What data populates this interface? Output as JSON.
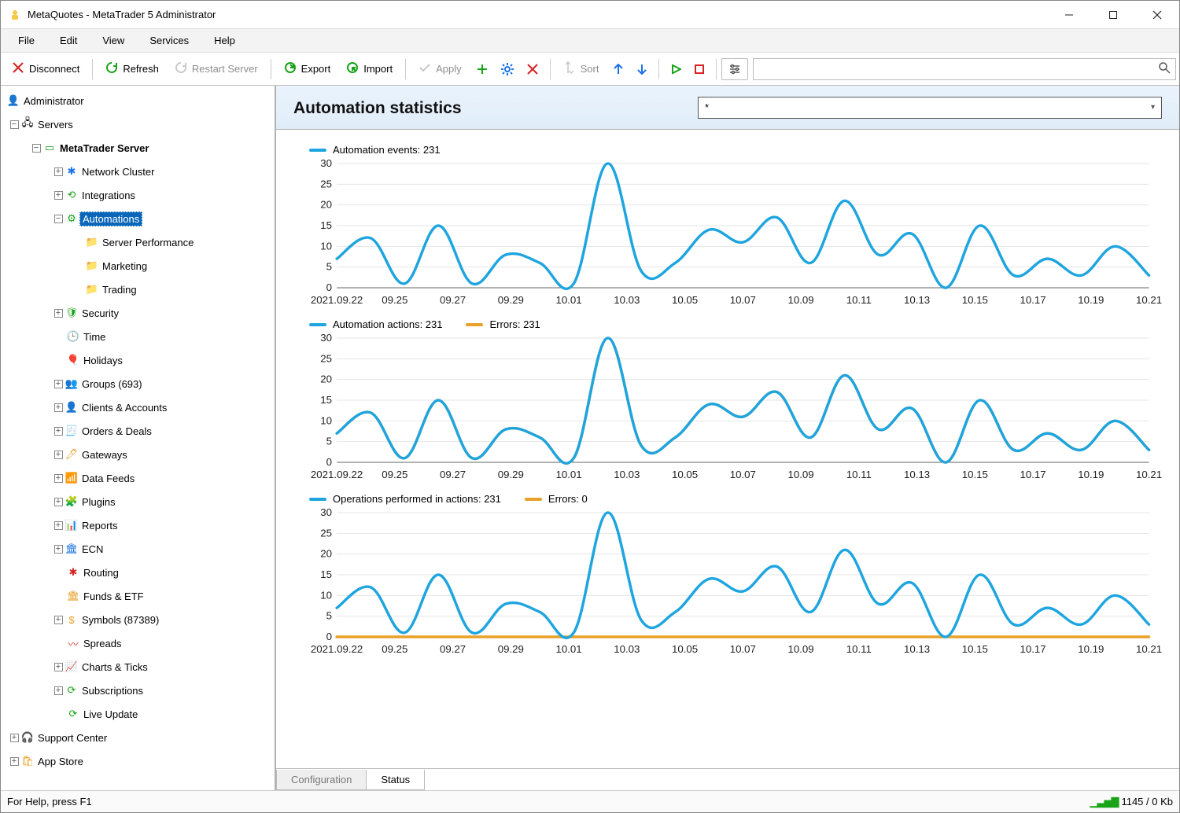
{
  "window": {
    "title": "MetaQuotes - MetaTrader 5 Administrator"
  },
  "menu": {
    "file": "File",
    "edit": "Edit",
    "view": "View",
    "services": "Services",
    "help": "Help"
  },
  "toolbar": {
    "disconnect": "Disconnect",
    "refresh": "Refresh",
    "restart": "Restart Server",
    "export": "Export",
    "import": "Import",
    "apply": "Apply",
    "sort": "Sort"
  },
  "tree": {
    "root": "Administrator",
    "servers": "Servers",
    "mtserver": "MetaTrader Server",
    "network_cluster": "Network Cluster",
    "integrations": "Integrations",
    "automations": "Automations",
    "server_performance": "Server Performance",
    "marketing": "Marketing",
    "trading": "Trading",
    "security": "Security",
    "time": "Time",
    "holidays": "Holidays",
    "groups": "Groups (693)",
    "clients": "Clients & Accounts",
    "orders": "Orders & Deals",
    "gateways": "Gateways",
    "datafeeds": "Data Feeds",
    "plugins": "Plugins",
    "reports": "Reports",
    "ecn": "ECN",
    "routing": "Routing",
    "funds": "Funds & ETF",
    "symbols": "Symbols (87389)",
    "spreads": "Spreads",
    "charts": "Charts & Ticks",
    "subscriptions": "Subscriptions",
    "liveupdate": "Live Update",
    "support": "Support Center",
    "appstore": "App Store"
  },
  "content": {
    "title": "Automation statistics",
    "filter_value": "*",
    "tabs": {
      "configuration": "Configuration",
      "status": "Status"
    }
  },
  "status": {
    "help": "For Help, press F1",
    "net": "1145 / 0 Kb"
  },
  "colors": {
    "blue": "#1ea5df",
    "orange": "#e9a129"
  },
  "chart_data": [
    {
      "type": "line",
      "title": "Automation events: 231",
      "ylim": [
        0,
        30
      ],
      "categories": [
        "2021.09.22",
        "09.25",
        "09.27",
        "09.29",
        "10.01",
        "10.03",
        "10.05",
        "10.07",
        "10.09",
        "10.11",
        "10.13",
        "10.15",
        "10.17",
        "10.19",
        "10.21"
      ],
      "series": [
        {
          "name": "Automation events: 231",
          "color": "#1ea5df",
          "values": [
            7,
            12,
            1,
            15,
            1,
            8,
            6,
            1,
            30,
            4,
            6,
            14,
            11,
            17,
            6,
            21,
            8,
            13,
            0,
            15,
            3,
            7,
            3,
            10,
            3
          ]
        }
      ]
    },
    {
      "type": "line",
      "title": "Automation actions / Errors",
      "ylim": [
        0,
        30
      ],
      "categories": [
        "2021.09.22",
        "09.25",
        "09.27",
        "09.29",
        "10.01",
        "10.03",
        "10.05",
        "10.07",
        "10.09",
        "10.11",
        "10.13",
        "10.15",
        "10.17",
        "10.19",
        "10.21"
      ],
      "series": [
        {
          "name": "Automation actions: 231",
          "color": "#1ea5df",
          "values": [
            7,
            12,
            1,
            15,
            1,
            8,
            6,
            1,
            30,
            4,
            6,
            14,
            11,
            17,
            6,
            21,
            8,
            13,
            0,
            15,
            3,
            7,
            3,
            10,
            3
          ]
        },
        {
          "name": "Errors: 231",
          "color": "#e9a129",
          "values": [
            7,
            12,
            1,
            15,
            1,
            8,
            6,
            1,
            30,
            4,
            6,
            14,
            11,
            17,
            6,
            21,
            8,
            13,
            0,
            15,
            3,
            7,
            3,
            10,
            3
          ]
        }
      ]
    },
    {
      "type": "line",
      "title": "Operations performed in actions / Errors",
      "ylim": [
        0,
        30
      ],
      "categories": [
        "2021.09.22",
        "09.25",
        "09.27",
        "09.29",
        "10.01",
        "10.03",
        "10.05",
        "10.07",
        "10.09",
        "10.11",
        "10.13",
        "10.15",
        "10.17",
        "10.19",
        "10.21"
      ],
      "series": [
        {
          "name": "Operations performed in actions: 231",
          "color": "#1ea5df",
          "values": [
            7,
            12,
            1,
            15,
            1,
            8,
            6,
            1,
            30,
            4,
            6,
            14,
            11,
            17,
            6,
            21,
            8,
            13,
            0,
            15,
            3,
            7,
            3,
            10,
            3
          ]
        },
        {
          "name": "Errors: 0",
          "color": "#e9a129",
          "values": [
            0,
            0,
            0,
            0,
            0,
            0,
            0,
            0,
            0,
            0,
            0,
            0,
            0,
            0,
            0,
            0,
            0,
            0,
            0,
            0,
            0,
            0,
            0,
            0,
            0
          ]
        }
      ]
    }
  ]
}
